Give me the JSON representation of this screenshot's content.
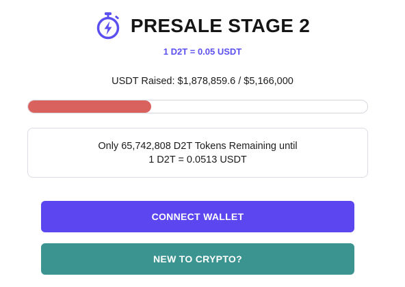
{
  "header": {
    "title": "PRESALE STAGE 2",
    "icon": "stopwatch-lightning-icon",
    "icon_color": "#5b4ff0"
  },
  "rate": "1 D2T = 0.05 USDT",
  "raised_text": "USDT Raised: $1,878,859.6 / $5,166,000",
  "progress": {
    "fraction": 0.3637,
    "fill_color": "#d9625f"
  },
  "remaining": {
    "line1": "Only 65,742,808 D2T Tokens Remaining until",
    "line2": "1 D2T = 0.0513 USDT"
  },
  "buttons": {
    "connect_label": "CONNECT WALLET",
    "connect_color": "#5b46f0",
    "new_label": "NEW TO CRYPTO?",
    "new_color": "#3c9490"
  }
}
